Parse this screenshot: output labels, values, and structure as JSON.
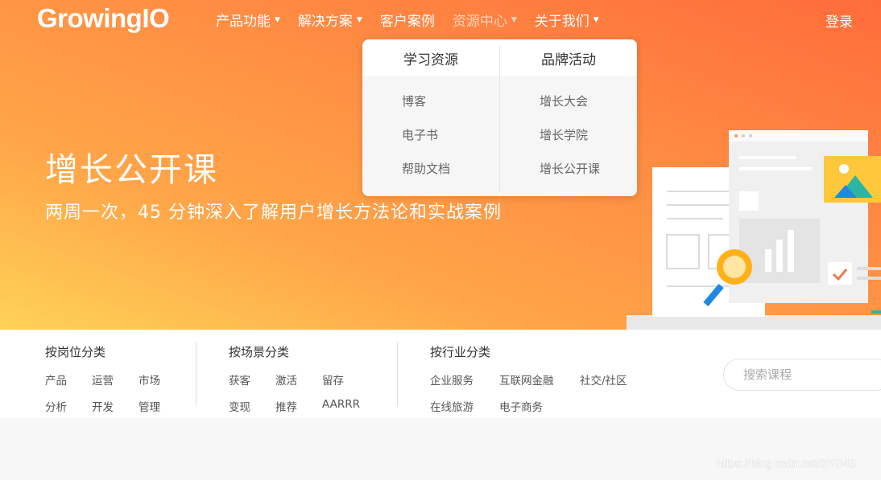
{
  "header": {
    "logo": "GrowingIO",
    "nav": [
      {
        "label": "产品功能"
      },
      {
        "label": "解决方案"
      },
      {
        "label": "客户案例"
      },
      {
        "label": "资源中心"
      },
      {
        "label": "关于我们"
      }
    ],
    "login": "登录"
  },
  "hero": {
    "title": "增长公开课",
    "subtitle": "两周一次，45 分钟深入了解用户增长方法论和实战案例"
  },
  "dropdown": {
    "left": {
      "heading": "学习资源",
      "links": [
        "博客",
        "电子书",
        "帮助文档"
      ]
    },
    "right": {
      "heading": "品牌活动",
      "links": [
        "增长大会",
        "增长学院",
        "增长公开课"
      ]
    }
  },
  "filters": {
    "position": {
      "heading": "按岗位分类",
      "row1": [
        "产品",
        "运营",
        "市场"
      ],
      "row2": [
        "分析",
        "开发",
        "管理"
      ]
    },
    "scene": {
      "heading": "按场景分类",
      "row1": [
        "获客",
        "激活",
        "留存"
      ],
      "row2": [
        "变现",
        "推荐",
        "AARRR"
      ]
    },
    "industry": {
      "heading": "按行业分类",
      "row1": [
        "企业服务",
        "互联网金融",
        "社交/社区"
      ],
      "row2": [
        "在线旅游",
        "电子商务"
      ]
    },
    "search_placeholder": "搜索课程"
  },
  "watermark": "https://blog.csdn.net/ZYD45",
  "colors": {
    "accent": "#ff8a44",
    "gradient_start": "#ffd257",
    "gradient_end": "#ff6c3b"
  }
}
